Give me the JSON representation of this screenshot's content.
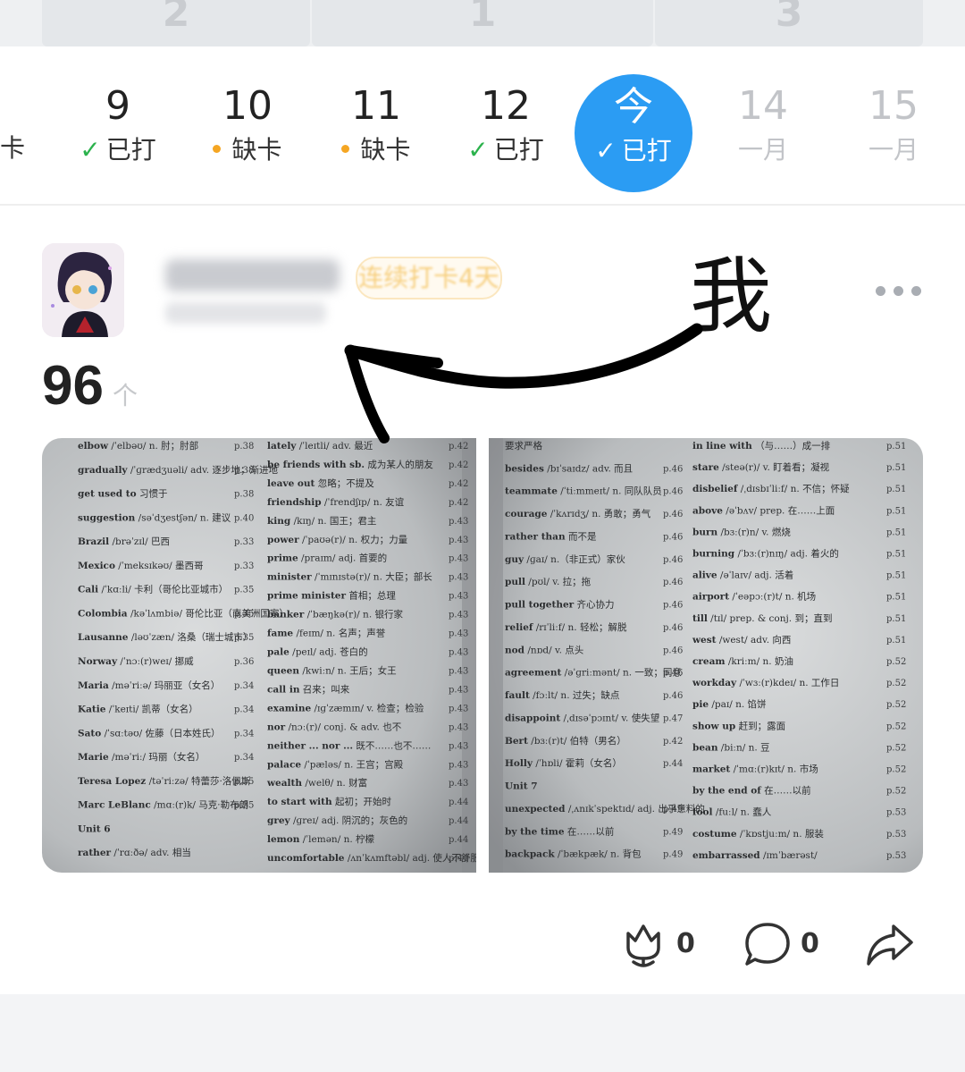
{
  "top_tabs": [
    "2",
    "1",
    "3"
  ],
  "calendar": {
    "partial_left_status": "卡",
    "days": [
      {
        "num": "9",
        "status": "已打",
        "kind": "done"
      },
      {
        "num": "10",
        "status": "缺卡",
        "kind": "missed"
      },
      {
        "num": "11",
        "status": "缺卡",
        "kind": "missed"
      },
      {
        "num": "12",
        "status": "已打",
        "kind": "done"
      }
    ],
    "today": {
      "label": "今",
      "status": "已打"
    },
    "future": [
      {
        "num": "14",
        "status": "一月"
      },
      {
        "num": "15",
        "status": "一月"
      }
    ],
    "colors": {
      "done": "#2bb24c",
      "missed": "#f5a623",
      "today_bg": "#2b9cf3"
    }
  },
  "post": {
    "streak_label": "连续打卡4天",
    "annotation": "我",
    "count": "96",
    "count_unit": "个",
    "photos": [
      {
        "left_col": [
          {
            "word": "elbow",
            "ph": "/ˈelbəʊ/",
            "def": "n. 肘；肘部",
            "page": "p.38"
          },
          {
            "word": "gradually",
            "ph": "/ˈɡrædʒuəli/",
            "def": "adv. 逐步地；渐进地",
            "page": "p.38"
          },
          {
            "word": "get used to",
            "ph": "",
            "def": "习惯于",
            "page": "p.38"
          },
          {
            "word": "suggestion",
            "ph": "/səˈdʒestʃən/",
            "def": "n. 建议",
            "page": "p.40"
          },
          {
            "word": "Brazil",
            "ph": "/brəˈzɪl/",
            "def": "巴西",
            "page": "p.33"
          },
          {
            "word": "Mexico",
            "ph": "/ˈmeksɪkəʊ/",
            "def": "墨西哥",
            "page": "p.33"
          },
          {
            "word": "Cali",
            "ph": "/ˈkɑːli/",
            "def": "卡利（哥伦比亚城市）",
            "page": "p.35"
          },
          {
            "word": "Colombia",
            "ph": "/kəˈlʌmbiə/",
            "def": "哥伦比亚（南美洲国家）",
            "page": "p.35"
          },
          {
            "word": "Lausanne",
            "ph": "/ləʊˈzæn/",
            "def": "洛桑（瑞士城市）",
            "page": "p.35"
          },
          {
            "word": "Norway",
            "ph": "/ˈnɔː(r)weɪ/",
            "def": "挪威",
            "page": "p.36"
          },
          {
            "word": "Maria",
            "ph": "/məˈriːə/",
            "def": "玛丽亚（女名）",
            "page": "p.34"
          },
          {
            "word": "Katie",
            "ph": "/ˈkeɪti/",
            "def": "凯蒂（女名）",
            "page": "p.34"
          },
          {
            "word": "Sato",
            "ph": "/ˈsɑːtəʊ/",
            "def": "佐藤（日本姓氏）",
            "page": "p.34"
          },
          {
            "word": "Marie",
            "ph": "/məˈriː/",
            "def": "玛丽（女名）",
            "page": "p.34"
          },
          {
            "word": "Teresa Lopez",
            "ph": "/təˈriːzə/",
            "def": "特蕾莎·洛佩斯",
            "page": "p.35"
          },
          {
            "word": "Marc LeBlanc",
            "ph": "/mɑː(r)k/",
            "def": "马克·勒布朗",
            "page": "p.35"
          },
          {
            "word": "Unit 6",
            "ph": "",
            "def": "",
            "page": ""
          },
          {
            "word": "rather",
            "ph": "/ˈrɑːðə/",
            "def": "adv. 相当",
            "page": ""
          }
        ],
        "right_col": [
          {
            "word": "lately",
            "ph": "/ˈleɪtli/",
            "def": "adv. 最近",
            "page": "p.42"
          },
          {
            "word": "be friends with sb.",
            "ph": "",
            "def": "成为某人的朋友",
            "page": "p.42"
          },
          {
            "word": "leave out",
            "ph": "",
            "def": "忽略；不提及",
            "page": "p.42"
          },
          {
            "word": "friendship",
            "ph": "/ˈfrendʃɪp/",
            "def": "n. 友谊",
            "page": "p.42"
          },
          {
            "word": "king",
            "ph": "/kɪŋ/",
            "def": "n. 国王；君主",
            "page": "p.43"
          },
          {
            "word": "power",
            "ph": "/ˈpaʊə(r)/",
            "def": "n. 权力；力量",
            "page": "p.43"
          },
          {
            "word": "prime",
            "ph": "/praɪm/",
            "def": "adj. 首要的",
            "page": "p.43"
          },
          {
            "word": "minister",
            "ph": "/ˈmɪnɪstə(r)/",
            "def": "n. 大臣；部长",
            "page": "p.43"
          },
          {
            "word": "prime minister",
            "ph": "",
            "def": "首相；总理",
            "page": "p.43"
          },
          {
            "word": "banker",
            "ph": "/ˈbæŋkə(r)/",
            "def": "n. 银行家",
            "page": "p.43"
          },
          {
            "word": "fame",
            "ph": "/feɪm/",
            "def": "n. 名声；声誉",
            "page": "p.43"
          },
          {
            "word": "pale",
            "ph": "/peɪl/",
            "def": "adj. 苍白的",
            "page": "p.43"
          },
          {
            "word": "queen",
            "ph": "/kwiːn/",
            "def": "n. 王后；女王",
            "page": "p.43"
          },
          {
            "word": "call in",
            "ph": "",
            "def": "召来；叫来",
            "page": "p.43"
          },
          {
            "word": "examine",
            "ph": "/ɪɡˈzæmɪn/",
            "def": "v. 检查；检验",
            "page": "p.43"
          },
          {
            "word": "nor",
            "ph": "/nɔː(r)/",
            "def": "conj. & adv. 也不",
            "page": "p.43"
          },
          {
            "word": "neither ... nor ...",
            "ph": "",
            "def": "既不……也不……",
            "page": "p.43"
          },
          {
            "word": "palace",
            "ph": "/ˈpæləs/",
            "def": "n. 王宫；宫殿",
            "page": "p.43"
          },
          {
            "word": "wealth",
            "ph": "/welθ/",
            "def": "n. 财富",
            "page": "p.43"
          },
          {
            "word": "to start with",
            "ph": "",
            "def": "起初；开始时",
            "page": "p.44"
          },
          {
            "word": "grey",
            "ph": "/ɡreɪ/",
            "def": "adj. 阴沉的；灰色的",
            "page": "p.44"
          },
          {
            "word": "lemon",
            "ph": "/ˈlemən/",
            "def": "n. 柠檬",
            "page": "p.44"
          },
          {
            "word": "uncomfortable",
            "ph": "/ʌnˈkʌmftəbl/",
            "def": "adj. 使人不舒服的",
            "page": "p.44"
          }
        ]
      },
      {
        "left_col": [
          {
            "word": "",
            "ph": "",
            "def": "要求严格",
            "page": ""
          },
          {
            "word": "besides",
            "ph": "/bɪˈsaɪdz/",
            "def": "adv. 而且",
            "page": "p.46"
          },
          {
            "word": "teammate",
            "ph": "/ˈtiːmmeɪt/",
            "def": "n. 同队队员",
            "page": "p.46"
          },
          {
            "word": "courage",
            "ph": "/ˈkʌrɪdʒ/",
            "def": "n. 勇敢；勇气",
            "page": "p.46"
          },
          {
            "word": "rather than",
            "ph": "",
            "def": "而不是",
            "page": "p.46"
          },
          {
            "word": "guy",
            "ph": "/ɡaɪ/",
            "def": "n.（非正式）家伙",
            "page": "p.46"
          },
          {
            "word": "pull",
            "ph": "/pʊl/",
            "def": "v. 拉；拖",
            "page": "p.46"
          },
          {
            "word": "pull together",
            "ph": "",
            "def": "齐心协力",
            "page": "p.46"
          },
          {
            "word": "relief",
            "ph": "/rɪˈliːf/",
            "def": "n. 轻松；解脱",
            "page": "p.46"
          },
          {
            "word": "nod",
            "ph": "/nɒd/",
            "def": "v. 点头",
            "page": "p.46"
          },
          {
            "word": "agreement",
            "ph": "/əˈɡriːmənt/",
            "def": "n. 一致；同意",
            "page": "p.46"
          },
          {
            "word": "fault",
            "ph": "/fɔːlt/",
            "def": "n. 过失；缺点",
            "page": "p.46"
          },
          {
            "word": "disappoint",
            "ph": "/ˌdɪsəˈpɔɪnt/",
            "def": "v. 使失望",
            "page": "p.47"
          },
          {
            "word": "Bert",
            "ph": "/bɜː(r)t/",
            "def": "伯特（男名）",
            "page": "p.42"
          },
          {
            "word": "Holly",
            "ph": "/ˈhɒli/",
            "def": "霍莉（女名）",
            "page": "p.44"
          },
          {
            "word": "Unit 7",
            "ph": "",
            "def": "",
            "page": ""
          },
          {
            "word": "unexpected",
            "ph": "/ˌʌnɪkˈspektɪd/",
            "def": "adj. 出乎意料的",
            "page": "p.49"
          },
          {
            "word": "by the time",
            "ph": "",
            "def": "在……以前",
            "page": "p.49"
          },
          {
            "word": "backpack",
            "ph": "/ˈbækpæk/",
            "def": "n. 背包",
            "page": "p.49"
          }
        ],
        "right_col": [
          {
            "word": "in line with",
            "ph": "",
            "def": "（与……）成一排",
            "page": "p.51"
          },
          {
            "word": "stare",
            "ph": "/steə(r)/",
            "def": "v. 盯着看；凝视",
            "page": "p.51"
          },
          {
            "word": "disbelief",
            "ph": "/ˌdɪsbɪˈliːf/",
            "def": "n. 不信；怀疑",
            "page": "p.51"
          },
          {
            "word": "above",
            "ph": "/əˈbʌv/",
            "def": "prep. 在……上面",
            "page": "p.51"
          },
          {
            "word": "burn",
            "ph": "/bɜː(r)n/",
            "def": "v. 燃烧",
            "page": "p.51"
          },
          {
            "word": "burning",
            "ph": "/ˈbɜː(r)nɪŋ/",
            "def": "adj. 着火的",
            "page": "p.51"
          },
          {
            "word": "alive",
            "ph": "/əˈlaɪv/",
            "def": "adj. 活着",
            "page": "p.51"
          },
          {
            "word": "airport",
            "ph": "/ˈeəpɔː(r)t/",
            "def": "n. 机场",
            "page": "p.51"
          },
          {
            "word": "till",
            "ph": "/tɪl/",
            "def": "prep. & conj. 到；直到",
            "page": "p.51"
          },
          {
            "word": "west",
            "ph": "/west/",
            "def": "adv. 向西",
            "page": "p.51"
          },
          {
            "word": "cream",
            "ph": "/kriːm/",
            "def": "n. 奶油",
            "page": "p.52"
          },
          {
            "word": "workday",
            "ph": "/ˈwɜː(r)kdeɪ/",
            "def": "n. 工作日",
            "page": "p.52"
          },
          {
            "word": "pie",
            "ph": "/paɪ/",
            "def": "n. 馅饼",
            "page": "p.52"
          },
          {
            "word": "show up",
            "ph": "",
            "def": "赶到；露面",
            "page": "p.52"
          },
          {
            "word": "bean",
            "ph": "/biːn/",
            "def": "n. 豆",
            "page": "p.52"
          },
          {
            "word": "market",
            "ph": "/ˈmɑː(r)kɪt/",
            "def": "n. 市场",
            "page": "p.52"
          },
          {
            "word": "by the end of",
            "ph": "",
            "def": "在……以前",
            "page": "p.52"
          },
          {
            "word": "fool",
            "ph": "/fuːl/",
            "def": "n. 蠢人",
            "page": "p.53"
          },
          {
            "word": "costume",
            "ph": "/ˈkɒstjuːm/",
            "def": "n. 服装",
            "page": "p.53"
          },
          {
            "word": "embarrassed",
            "ph": "/ɪmˈbærəst/",
            "def": "",
            "page": "p.53"
          }
        ]
      }
    ],
    "actions": {
      "like_count": "0",
      "comment_count": "0"
    }
  }
}
